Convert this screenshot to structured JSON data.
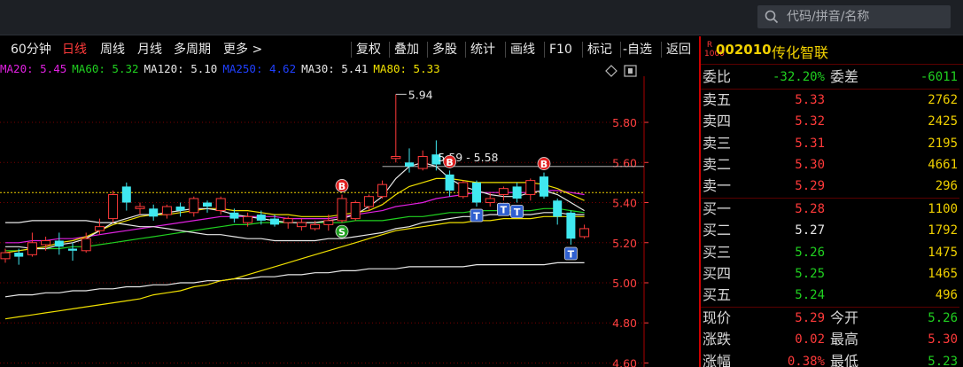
{
  "search": {
    "placeholder": "代码/拼音/名称"
  },
  "toolbar": {
    "period_label": "60分钟",
    "items": [
      {
        "label": "日线",
        "active": true
      },
      {
        "label": "周线"
      },
      {
        "label": "月线"
      },
      {
        "label": "多周期"
      },
      {
        "label": "更多 >"
      }
    ],
    "right_items": [
      "复权",
      "叠加",
      "多股",
      "统计",
      "画线",
      "F10",
      "标记",
      "-自选",
      "返回"
    ]
  },
  "ma_legend": [
    {
      "label": "MA20: 5.45",
      "color": "#e020e0"
    },
    {
      "label": "MA60: 5.32",
      "color": "#20d020"
    },
    {
      "label": "MA120: 5.10",
      "color": "#e8e8e8"
    },
    {
      "label": "MA250: 4.62",
      "color": "#2040ff"
    },
    {
      "label": "MA30: 5.41",
      "color": "#e8e8e8"
    },
    {
      "label": "MA80: 5.33",
      "color": "#f0e000"
    }
  ],
  "chart_data": {
    "type": "candlestick",
    "y_ticks": [
      5.8,
      5.6,
      5.4,
      5.2,
      5.0,
      4.8,
      4.6
    ],
    "y_tick_labels": [
      "5.80",
      "5.60",
      "5.40",
      "5.20",
      "5.00",
      "4.80",
      "4.60"
    ],
    "ylim": [
      4.58,
      6.03
    ],
    "annotations": {
      "high_label": "5.94",
      "range_label": "5.59 - 5.58",
      "reference_price": 5.58,
      "last_close_line": 5.45
    },
    "candles": [
      {
        "o": 5.12,
        "c": 5.15,
        "h": 5.17,
        "l": 5.1
      },
      {
        "o": 5.15,
        "c": 5.13,
        "h": 5.17,
        "l": 5.09
      },
      {
        "o": 5.14,
        "c": 5.2,
        "h": 5.25,
        "l": 5.13
      },
      {
        "o": 5.19,
        "c": 5.21,
        "h": 5.23,
        "l": 5.16
      },
      {
        "o": 5.21,
        "c": 5.18,
        "h": 5.25,
        "l": 5.14
      },
      {
        "o": 5.17,
        "c": 5.16,
        "h": 5.2,
        "l": 5.11
      },
      {
        "o": 5.16,
        "c": 5.22,
        "h": 5.25,
        "l": 5.15
      },
      {
        "o": 5.26,
        "c": 5.28,
        "h": 5.32,
        "l": 5.24
      },
      {
        "o": 5.32,
        "c": 5.44,
        "h": 5.46,
        "l": 5.3
      },
      {
        "o": 5.48,
        "c": 5.4,
        "h": 5.5,
        "l": 5.36
      },
      {
        "o": 5.37,
        "c": 5.38,
        "h": 5.4,
        "l": 5.34
      },
      {
        "o": 5.37,
        "c": 5.33,
        "h": 5.39,
        "l": 5.31
      },
      {
        "o": 5.34,
        "c": 5.38,
        "h": 5.39,
        "l": 5.32
      },
      {
        "o": 5.38,
        "c": 5.36,
        "h": 5.4,
        "l": 5.33
      },
      {
        "o": 5.35,
        "c": 5.42,
        "h": 5.43,
        "l": 5.33
      },
      {
        "o": 5.4,
        "c": 5.38,
        "h": 5.41,
        "l": 5.35
      },
      {
        "o": 5.36,
        "c": 5.42,
        "h": 5.43,
        "l": 5.34
      },
      {
        "o": 5.35,
        "c": 5.32,
        "h": 5.37,
        "l": 5.3
      },
      {
        "o": 5.3,
        "c": 5.33,
        "h": 5.35,
        "l": 5.28
      },
      {
        "o": 5.34,
        "c": 5.31,
        "h": 5.36,
        "l": 5.29
      },
      {
        "o": 5.32,
        "c": 5.29,
        "h": 5.34,
        "l": 5.28
      },
      {
        "o": 5.3,
        "c": 5.32,
        "h": 5.33,
        "l": 5.27
      },
      {
        "o": 5.28,
        "c": 5.3,
        "h": 5.32,
        "l": 5.26
      },
      {
        "o": 5.27,
        "c": 5.29,
        "h": 5.31,
        "l": 5.26
      },
      {
        "o": 5.29,
        "c": 5.31,
        "h": 5.34,
        "l": 5.26
      },
      {
        "o": 5.31,
        "c": 5.42,
        "h": 5.44,
        "l": 5.3
      },
      {
        "o": 5.32,
        "c": 5.4,
        "h": 5.41,
        "l": 5.31
      },
      {
        "o": 5.38,
        "c": 5.43,
        "h": 5.44,
        "l": 5.36
      },
      {
        "o": 5.43,
        "c": 5.49,
        "h": 5.51,
        "l": 5.42
      },
      {
        "o": 5.62,
        "c": 5.63,
        "h": 5.94,
        "l": 5.6
      },
      {
        "o": 5.6,
        "c": 5.58,
        "h": 5.67,
        "l": 5.55
      },
      {
        "o": 5.57,
        "c": 5.63,
        "h": 5.66,
        "l": 5.56
      },
      {
        "o": 5.64,
        "c": 5.59,
        "h": 5.71,
        "l": 5.56
      },
      {
        "o": 5.54,
        "c": 5.46,
        "h": 5.56,
        "l": 5.43
      },
      {
        "o": 5.43,
        "c": 5.5,
        "h": 5.51,
        "l": 5.42
      },
      {
        "o": 5.5,
        "c": 5.4,
        "h": 5.51,
        "l": 5.38
      },
      {
        "o": 5.4,
        "c": 5.42,
        "h": 5.45,
        "l": 5.38
      },
      {
        "o": 5.44,
        "c": 5.47,
        "h": 5.48,
        "l": 5.41
      },
      {
        "o": 5.48,
        "c": 5.42,
        "h": 5.5,
        "l": 5.4
      },
      {
        "o": 5.44,
        "c": 5.51,
        "h": 5.52,
        "l": 5.41
      },
      {
        "o": 5.53,
        "c": 5.43,
        "h": 5.55,
        "l": 5.42
      },
      {
        "o": 5.41,
        "c": 5.33,
        "h": 5.42,
        "l": 5.29
      },
      {
        "o": 5.35,
        "c": 5.22,
        "h": 5.36,
        "l": 5.19
      },
      {
        "o": 5.23,
        "c": 5.27,
        "h": 5.29,
        "l": 5.22
      }
    ],
    "ma_lines": [
      {
        "name": "MA20",
        "color": "#e020e0",
        "values": [
          5.2,
          5.2,
          5.21,
          5.21,
          5.22,
          5.22,
          5.23,
          5.24,
          5.25,
          5.26,
          5.27,
          5.28,
          5.29,
          5.3,
          5.31,
          5.32,
          5.33,
          5.33,
          5.33,
          5.33,
          5.33,
          5.32,
          5.32,
          5.32,
          5.32,
          5.33,
          5.34,
          5.35,
          5.36,
          5.38,
          5.39,
          5.4,
          5.42,
          5.43,
          5.44,
          5.45,
          5.45,
          5.45,
          5.45,
          5.45,
          5.46,
          5.46,
          5.45,
          5.44
        ]
      },
      {
        "name": "MA60",
        "color": "#20d020",
        "values": [
          5.16,
          5.16,
          5.17,
          5.17,
          5.17,
          5.18,
          5.18,
          5.19,
          5.2,
          5.21,
          5.22,
          5.23,
          5.24,
          5.25,
          5.26,
          5.27,
          5.28,
          5.29,
          5.29,
          5.3,
          5.3,
          5.3,
          5.3,
          5.3,
          5.3,
          5.3,
          5.31,
          5.31,
          5.31,
          5.32,
          5.33,
          5.33,
          5.34,
          5.35,
          5.35,
          5.36,
          5.36,
          5.36,
          5.36,
          5.36,
          5.37,
          5.37,
          5.36,
          5.35
        ]
      },
      {
        "name": "MA120",
        "color": "#e8e8e8",
        "values": [
          5.3,
          5.3,
          5.31,
          5.31,
          5.31,
          5.31,
          5.31,
          5.3,
          5.3,
          5.29,
          5.28,
          5.28,
          5.27,
          5.26,
          5.25,
          5.24,
          5.24,
          5.23,
          5.22,
          5.22,
          5.21,
          5.21,
          5.21,
          5.21,
          5.22,
          5.22,
          5.23,
          5.24,
          5.25,
          5.27,
          5.28,
          5.3,
          5.31,
          5.32,
          5.33,
          5.33,
          5.34,
          5.34,
          5.34,
          5.34,
          5.35,
          5.35,
          5.34,
          5.34
        ]
      },
      {
        "name": "MA250",
        "color": "#e8e8e8",
        "values": [
          4.93,
          4.94,
          4.94,
          4.95,
          4.95,
          4.96,
          4.96,
          4.97,
          4.97,
          4.98,
          4.98,
          4.99,
          4.99,
          5.0,
          5.0,
          5.01,
          5.01,
          5.02,
          5.02,
          5.03,
          5.03,
          5.04,
          5.04,
          5.05,
          5.05,
          5.06,
          5.06,
          5.07,
          5.07,
          5.07,
          5.08,
          5.08,
          5.08,
          5.08,
          5.08,
          5.09,
          5.09,
          5.09,
          5.09,
          5.09,
          5.09,
          5.1,
          5.1,
          5.1
        ]
      },
      {
        "name": "MA30",
        "color": "#f0e000",
        "values": [
          5.15,
          5.16,
          5.17,
          5.18,
          5.2,
          5.21,
          5.23,
          5.26,
          5.29,
          5.31,
          5.33,
          5.34,
          5.34,
          5.35,
          5.36,
          5.37,
          5.37,
          5.36,
          5.36,
          5.35,
          5.34,
          5.34,
          5.33,
          5.33,
          5.33,
          5.34,
          5.35,
          5.36,
          5.39,
          5.44,
          5.48,
          5.5,
          5.52,
          5.52,
          5.51,
          5.5,
          5.5,
          5.5,
          5.5,
          5.5,
          5.49,
          5.47,
          5.44,
          5.41
        ]
      },
      {
        "name": "MA80",
        "color": "#f0e000",
        "values": [
          4.82,
          4.83,
          4.84,
          4.85,
          4.86,
          4.87,
          4.88,
          4.89,
          4.9,
          4.91,
          4.92,
          4.94,
          4.95,
          4.96,
          4.98,
          4.99,
          5.01,
          5.02,
          5.04,
          5.06,
          5.08,
          5.1,
          5.12,
          5.14,
          5.16,
          5.18,
          5.2,
          5.22,
          5.24,
          5.26,
          5.27,
          5.28,
          5.29,
          5.3,
          5.3,
          5.31,
          5.31,
          5.32,
          5.32,
          5.32,
          5.33,
          5.33,
          5.33,
          5.33
        ]
      },
      {
        "name": "white-fast",
        "color": "#e8e8e8",
        "values": [
          5.18,
          5.18,
          5.17,
          5.17,
          5.19,
          5.2,
          5.22,
          5.26,
          5.3,
          5.32,
          5.34,
          5.34,
          5.35,
          5.36,
          5.37,
          5.37,
          5.36,
          5.34,
          5.33,
          5.32,
          5.31,
          5.3,
          5.3,
          5.3,
          5.31,
          5.32,
          5.34,
          5.38,
          5.43,
          5.52,
          5.58,
          5.6,
          5.58,
          5.52,
          5.48,
          5.46,
          5.44,
          5.43,
          5.43,
          5.45,
          5.46,
          5.44,
          5.4,
          5.36
        ]
      }
    ],
    "signals": [
      {
        "index": 25,
        "label": "B",
        "position": "above",
        "color": "#e02020"
      },
      {
        "index": 25,
        "label": "S",
        "position": "below",
        "color": "#20a020"
      },
      {
        "index": 33,
        "label": "B",
        "position": "above",
        "color": "#e02020"
      },
      {
        "index": 40,
        "label": "B",
        "position": "above",
        "color": "#e02020"
      },
      {
        "index": 35,
        "label": "T",
        "position": "below",
        "color": "#3060d0"
      },
      {
        "index": 37,
        "label": "T",
        "position": "below",
        "color": "#3060d0"
      },
      {
        "index": 38,
        "label": "T",
        "position": "below",
        "color": "#3060d0"
      },
      {
        "index": 42,
        "label": "T",
        "position": "below",
        "color": "#3060d0"
      }
    ]
  },
  "quote_panel": {
    "tag": "R 1000",
    "code": "002010",
    "name": "传化智联",
    "weibi": {
      "label": "委比",
      "value": "-32.20%",
      "label2": "委差",
      "value2": "-6011"
    },
    "asks": [
      {
        "label": "卖五",
        "price": "5.33",
        "vol": "2762",
        "color": "#ff3a3a"
      },
      {
        "label": "卖四",
        "price": "5.32",
        "vol": "2425",
        "color": "#ff3a3a"
      },
      {
        "label": "卖三",
        "price": "5.31",
        "vol": "2195",
        "color": "#ff3a3a"
      },
      {
        "label": "卖二",
        "price": "5.30",
        "vol": "4661",
        "color": "#ff3a3a"
      },
      {
        "label": "卖一",
        "price": "5.29",
        "vol": "296",
        "color": "#ff3a3a"
      }
    ],
    "bids": [
      {
        "label": "买一",
        "price": "5.28",
        "vol": "1100",
        "color": "#ff3a3a"
      },
      {
        "label": "买二",
        "price": "5.27",
        "vol": "1792",
        "color": "#e8e8e8"
      },
      {
        "label": "买三",
        "price": "5.26",
        "vol": "1475",
        "color": "#20d020"
      },
      {
        "label": "买四",
        "price": "5.25",
        "vol": "1465",
        "color": "#20d020"
      },
      {
        "label": "买五",
        "price": "5.24",
        "vol": "496",
        "color": "#20d020"
      }
    ],
    "stats": [
      {
        "label": "现价",
        "value": "5.29",
        "label2": "今开",
        "value2": "5.26",
        "c1": "#ff3a3a",
        "c2": "#20d020"
      },
      {
        "label": "涨跌",
        "value": "0.02",
        "label2": "最高",
        "value2": "5.30",
        "c1": "#ff3a3a",
        "c2": "#ff3a3a"
      },
      {
        "label": "涨幅",
        "value": "0.38%",
        "label2": "最低",
        "value2": "5.23",
        "c1": "#ff3a3a",
        "c2": "#20d020"
      }
    ]
  },
  "colors": {
    "up": "#ff3a3a",
    "down": "#40e8f0",
    "grid": "#7a0000",
    "axis_text": "#ff4040"
  }
}
